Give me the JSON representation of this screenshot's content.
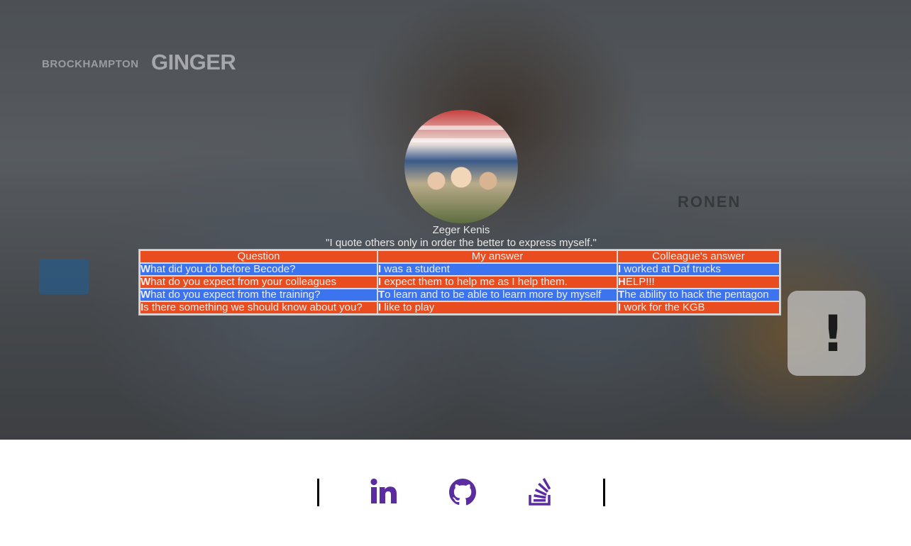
{
  "hero": {
    "brand_small": "BROCKHAMPTON",
    "brand_big": "GINGER",
    "background_text": "RONEN",
    "warning_glyph": "!"
  },
  "profile": {
    "name": "Zeger Kenis",
    "quote": "\"I quote others only in order the better to express myself.\""
  },
  "table": {
    "headers": [
      "Question",
      "My answer",
      "Colleague's answer"
    ],
    "rows": [
      [
        "What did you do before Becode?",
        "I was a student",
        "I worked at Daf trucks"
      ],
      [
        "What do you expect from your colleagues",
        "I expect them to help me as I help them.",
        "HELP!!!"
      ],
      [
        "What do you expect from the training?",
        "To learn and to be able to learn more by myself",
        "The ability to hack the pentagon"
      ],
      [
        "Is there something we should know about you?",
        "I like to play",
        "I work for the KGB"
      ]
    ]
  },
  "social": {
    "icons": [
      "linkedin-icon",
      "github-icon",
      "stackoverflow-icon"
    ],
    "color": "#5b2ca0"
  },
  "colors": {
    "header_row": "#e94d1f",
    "blue_row": "#3c74f0",
    "orange_row": "#e94d1f"
  }
}
